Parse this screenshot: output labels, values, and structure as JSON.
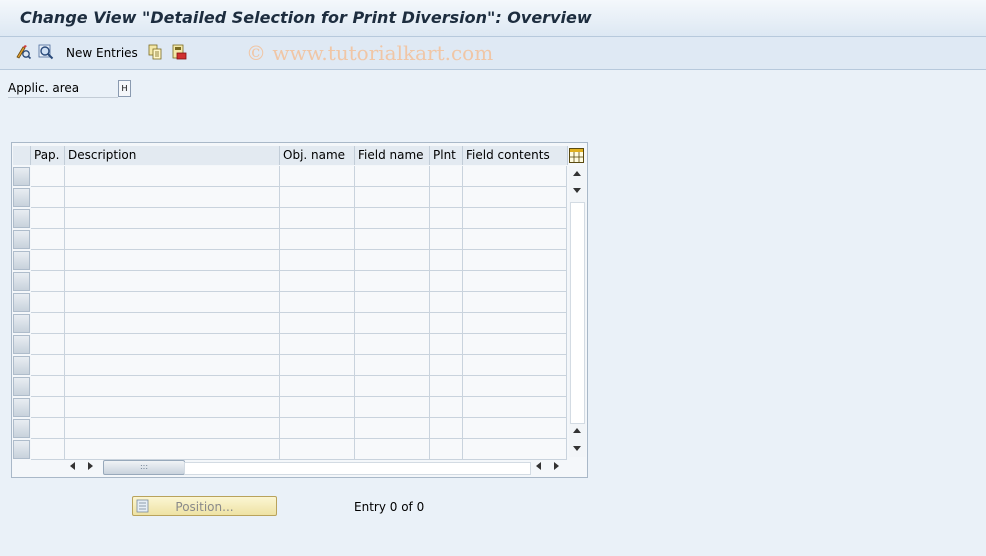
{
  "window": {
    "title": "Change View \"Detailed Selection for Print Diversion\": Overview"
  },
  "toolbar": {
    "items": [
      {
        "icon": "display-change-icon"
      },
      {
        "icon": "find-icon"
      },
      {
        "label": "New Entries"
      },
      {
        "icon": "copy-icon"
      },
      {
        "icon": "delete-icon"
      }
    ],
    "watermark": "© www.tutorialkart.com"
  },
  "selection": {
    "label": "Applic. area",
    "value": "H"
  },
  "table": {
    "columns": [
      "Pap.",
      "Description",
      "Obj. name",
      "Field name",
      "Plnt",
      "Field contents"
    ],
    "row_count": 14,
    "rows": []
  },
  "footer": {
    "position_button": "Position...",
    "entry_text": "Entry 0 of 0"
  },
  "colors": {
    "background": "#eaf1f8",
    "title_text": "#1d2d3f",
    "watermark": "#f0c6a6",
    "position_button": "#fbf6d3"
  }
}
